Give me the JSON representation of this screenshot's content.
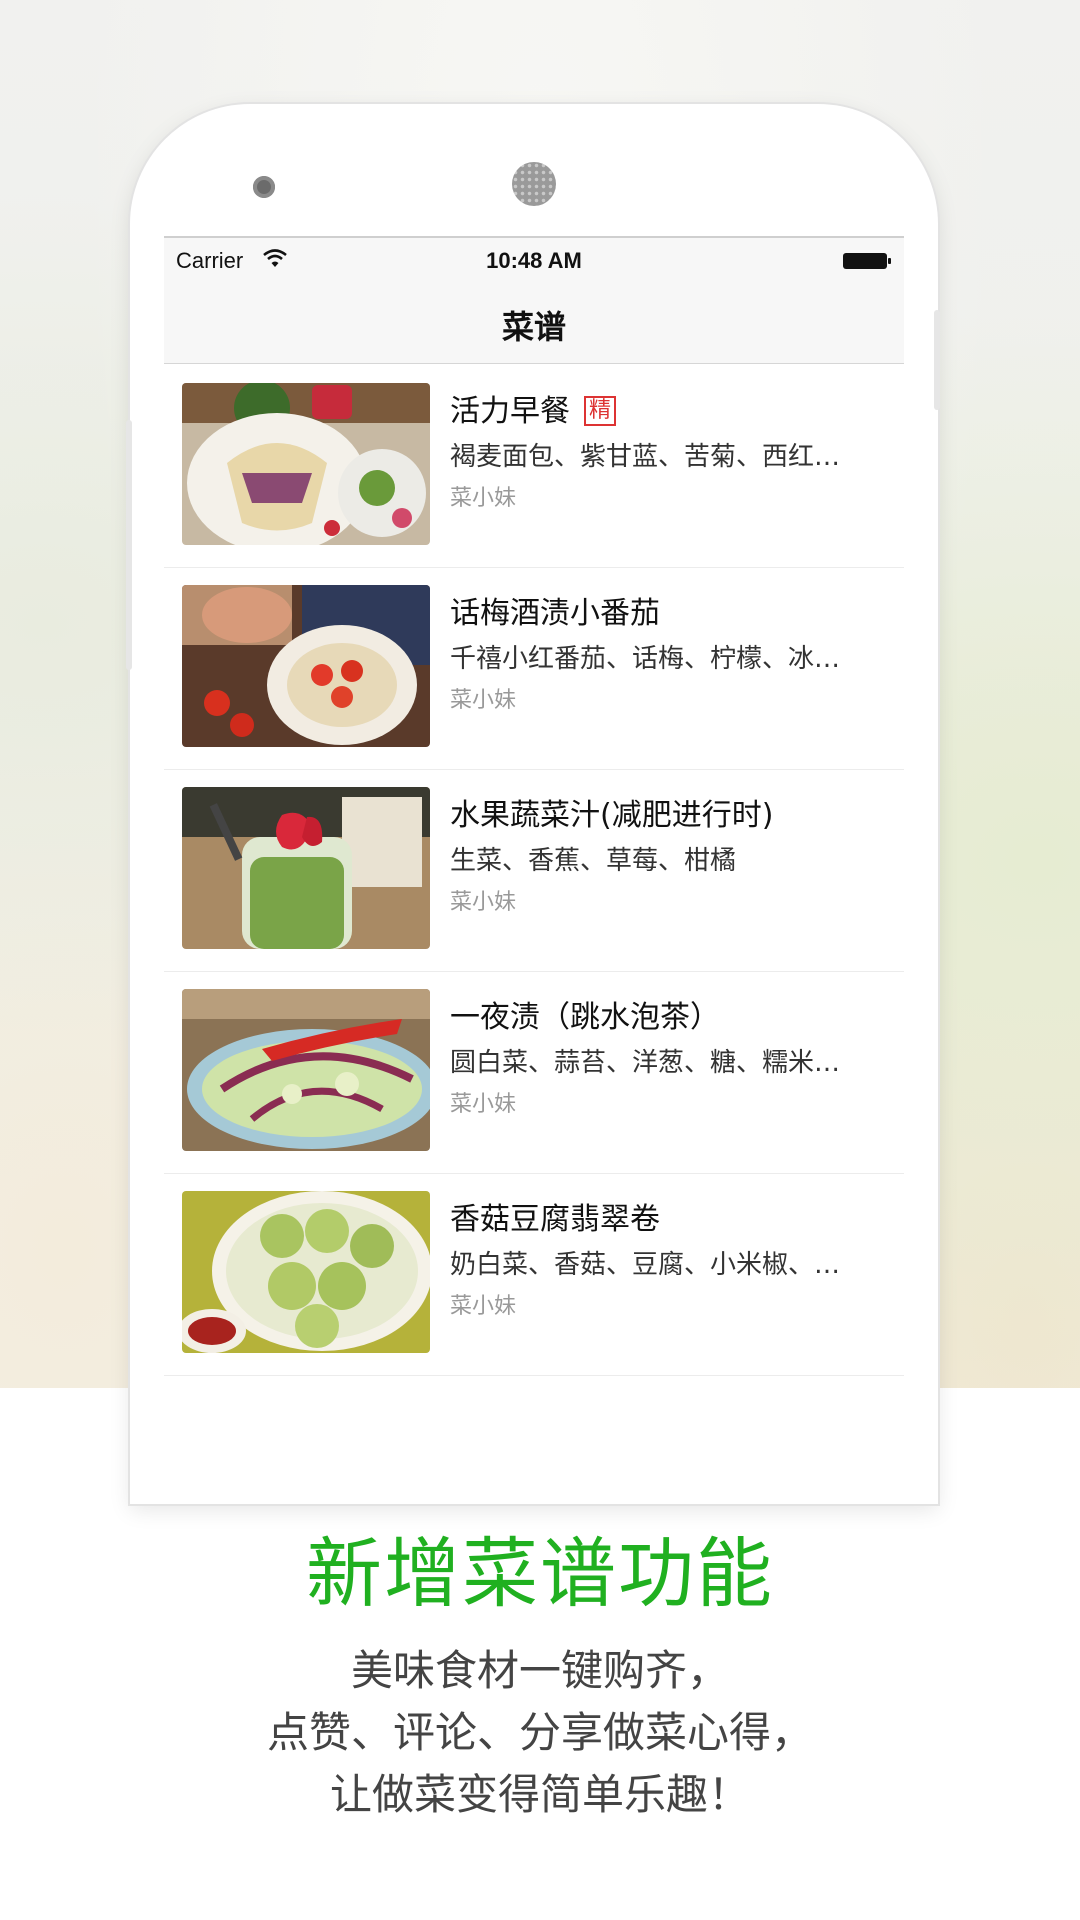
{
  "status_bar": {
    "carrier": "Carrier",
    "time": "10:48 AM"
  },
  "nav": {
    "title": "菜谱"
  },
  "recipes": [
    {
      "title": "活力早餐",
      "tag": "精",
      "ingredients": "褐麦面包、紫甘蓝、苦菊、西红…",
      "author": "菜小妹"
    },
    {
      "title": "话梅酒渍小番茄",
      "ingredients": "千禧小红番茄、话梅、柠檬、冰…",
      "author": "菜小妹"
    },
    {
      "title": "水果蔬菜汁(减肥进行时)",
      "ingredients": "生菜、香蕉、草莓、柑橘",
      "author": "菜小妹"
    },
    {
      "title": "一夜渍（跳水泡茶）",
      "ingredients": "圆白菜、蒜苔、洋葱、糖、糯米…",
      "author": "菜小妹"
    },
    {
      "title": "香菇豆腐翡翠卷",
      "ingredients": "奶白菜、香菇、豆腐、小米椒、…",
      "author": "菜小妹"
    }
  ],
  "promo": {
    "headline": "新增菜谱功能",
    "lines": [
      "美味食材一键购齐，",
      "点赞、评论、分享做菜心得，",
      "让做菜变得简单乐趣！"
    ]
  },
  "colors": {
    "accent": "#20b020",
    "tag": "#dd3333"
  },
  "icons": [
    "wifi-icon",
    "battery-icon",
    "camera-icon",
    "speaker-icon"
  ]
}
